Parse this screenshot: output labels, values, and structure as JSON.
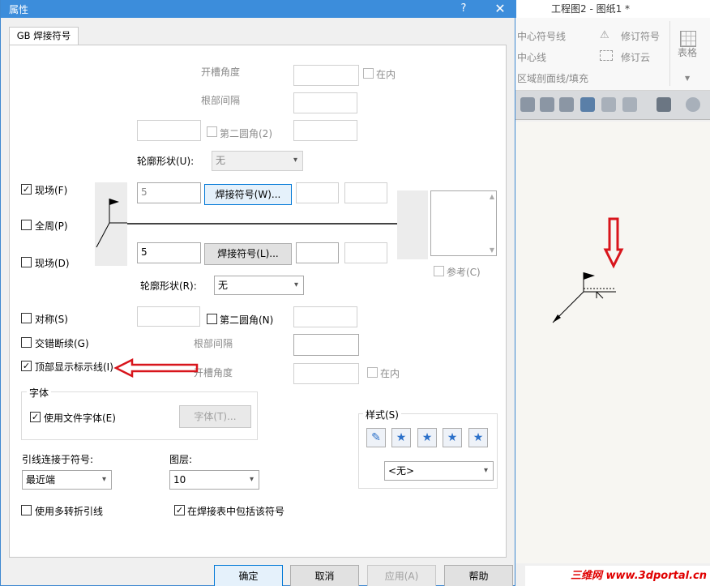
{
  "app": {
    "title": "工程图2 - 图纸1 *",
    "ribbon": {
      "center_mark_line": "中心符号线",
      "center_line": "中心线",
      "area_hatch": "区域剖面线/填充",
      "revision_symbol": "修订符号",
      "revision_cloud": "修订云",
      "table": "表格"
    },
    "watermark": "三维网 www.3dportal.cn"
  },
  "dialog": {
    "title": "属性",
    "help_glyph": "?",
    "close_glyph": "✕",
    "tab": "GB 焊接符号",
    "top": {
      "groove_angle_label": "开槽角度",
      "inside_label": "在内",
      "root_gap_label": "根部间隔",
      "second_fillet_label": "第二圆角(2)",
      "contour_label": "轮廓形状(U):",
      "contour_value": "无"
    },
    "field_site_top": "现场(F)",
    "all_around": "全周(P)",
    "field_site_bottom": "现场(D)",
    "upper_size_value": "5",
    "upper_symbol_button": "焊接符号(W)...",
    "lower_size_value": "5",
    "lower_symbol_button": "焊接符号(L)...",
    "reference_label": "参考(C)",
    "bottom": {
      "contour_label": "轮廓形状(R):",
      "contour_value": "无",
      "symmetric": "对称(S)",
      "second_fillet_label": "第二圆角(N)",
      "staggered": "交错断续(G)",
      "root_gap_label": "根部间隔",
      "show_top_line": "顶部显示标示线(I)",
      "groove_angle_label": "开槽角度",
      "inside_label": "在内"
    },
    "font": {
      "group_label": "字体",
      "use_doc_font": "使用文件字体(E)",
      "font_button": "字体(T)..."
    },
    "style": {
      "group_label": "样式(S)",
      "value": "<无>"
    },
    "leader_attach_label": "引线连接于符号:",
    "leader_attach_value": "最近端",
    "layer_label": "图层:",
    "layer_value": "10",
    "multi_jog_leader": "使用多转折引线",
    "include_in_table": "在焊接表中包括该符号",
    "buttons": {
      "ok": "确定",
      "cancel": "取消",
      "apply": "应用(A)",
      "help": "帮助"
    }
  },
  "colors": {
    "title_bar": "#3c8ddb",
    "annotation_arrow": "#d8151c"
  }
}
